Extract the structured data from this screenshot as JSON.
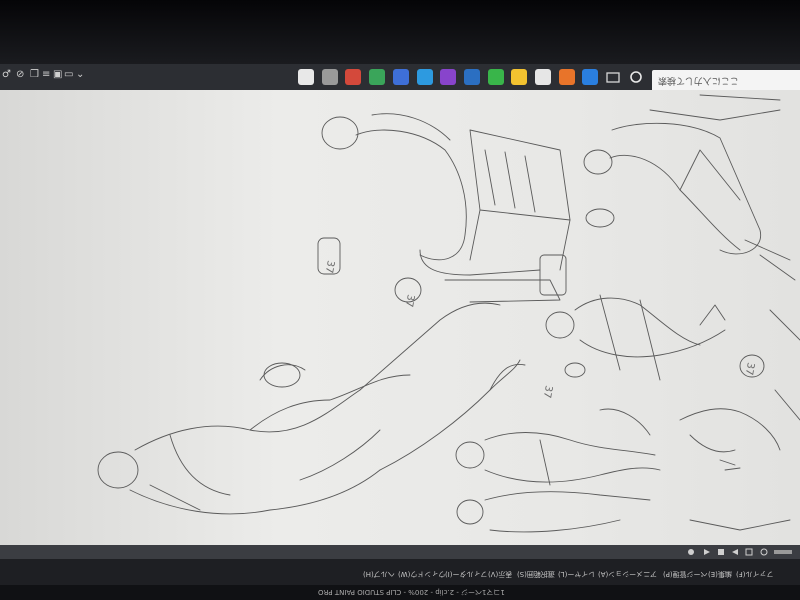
{
  "taskbar": {
    "quick_access": [
      "♂",
      "⊘",
      "❒",
      "≡",
      "▣",
      "▭",
      "⌄"
    ],
    "apps": [
      {
        "name": "app-icon-1",
        "color": "#e8e8e8"
      },
      {
        "name": "app-icon-2",
        "color": "#9a9a9a"
      },
      {
        "name": "app-icon-3",
        "color": "#d4493b"
      },
      {
        "name": "app-icon-4",
        "color": "#3aa55a"
      },
      {
        "name": "app-icon-5",
        "color": "#3e6fd8"
      },
      {
        "name": "app-icon-6",
        "color": "#2d9ae0"
      },
      {
        "name": "app-icon-7",
        "color": "#8844cc"
      },
      {
        "name": "app-icon-8",
        "color": "#2b6fc2"
      },
      {
        "name": "app-icon-9",
        "color": "#39b54a"
      },
      {
        "name": "app-icon-10",
        "color": "#f2c230"
      },
      {
        "name": "app-icon-11",
        "color": "#e6e6e6"
      },
      {
        "name": "app-icon-12",
        "color": "#e8742a"
      },
      {
        "name": "app-icon-13",
        "color": "#2a7fe0"
      }
    ],
    "search_placeholder": "ここに入力して検索"
  },
  "canvas": {
    "page_number_labels": [
      "37",
      "37",
      "37",
      "37"
    ]
  },
  "menu_bar": {
    "items": [
      "ファイル(F)",
      "編集(E)",
      "ページ管理(P)",
      "アニメーション(A)",
      "レイヤー(L)",
      "選択範囲(S)",
      "表示(V)",
      "フィルター(I)",
      "ウィンドウ(W)",
      "ヘルプ(H)"
    ]
  },
  "title_bar": {
    "title": "1コマ1ページ - 2.clip - 200% - CLIP STUDIO PAINT PRO"
  }
}
